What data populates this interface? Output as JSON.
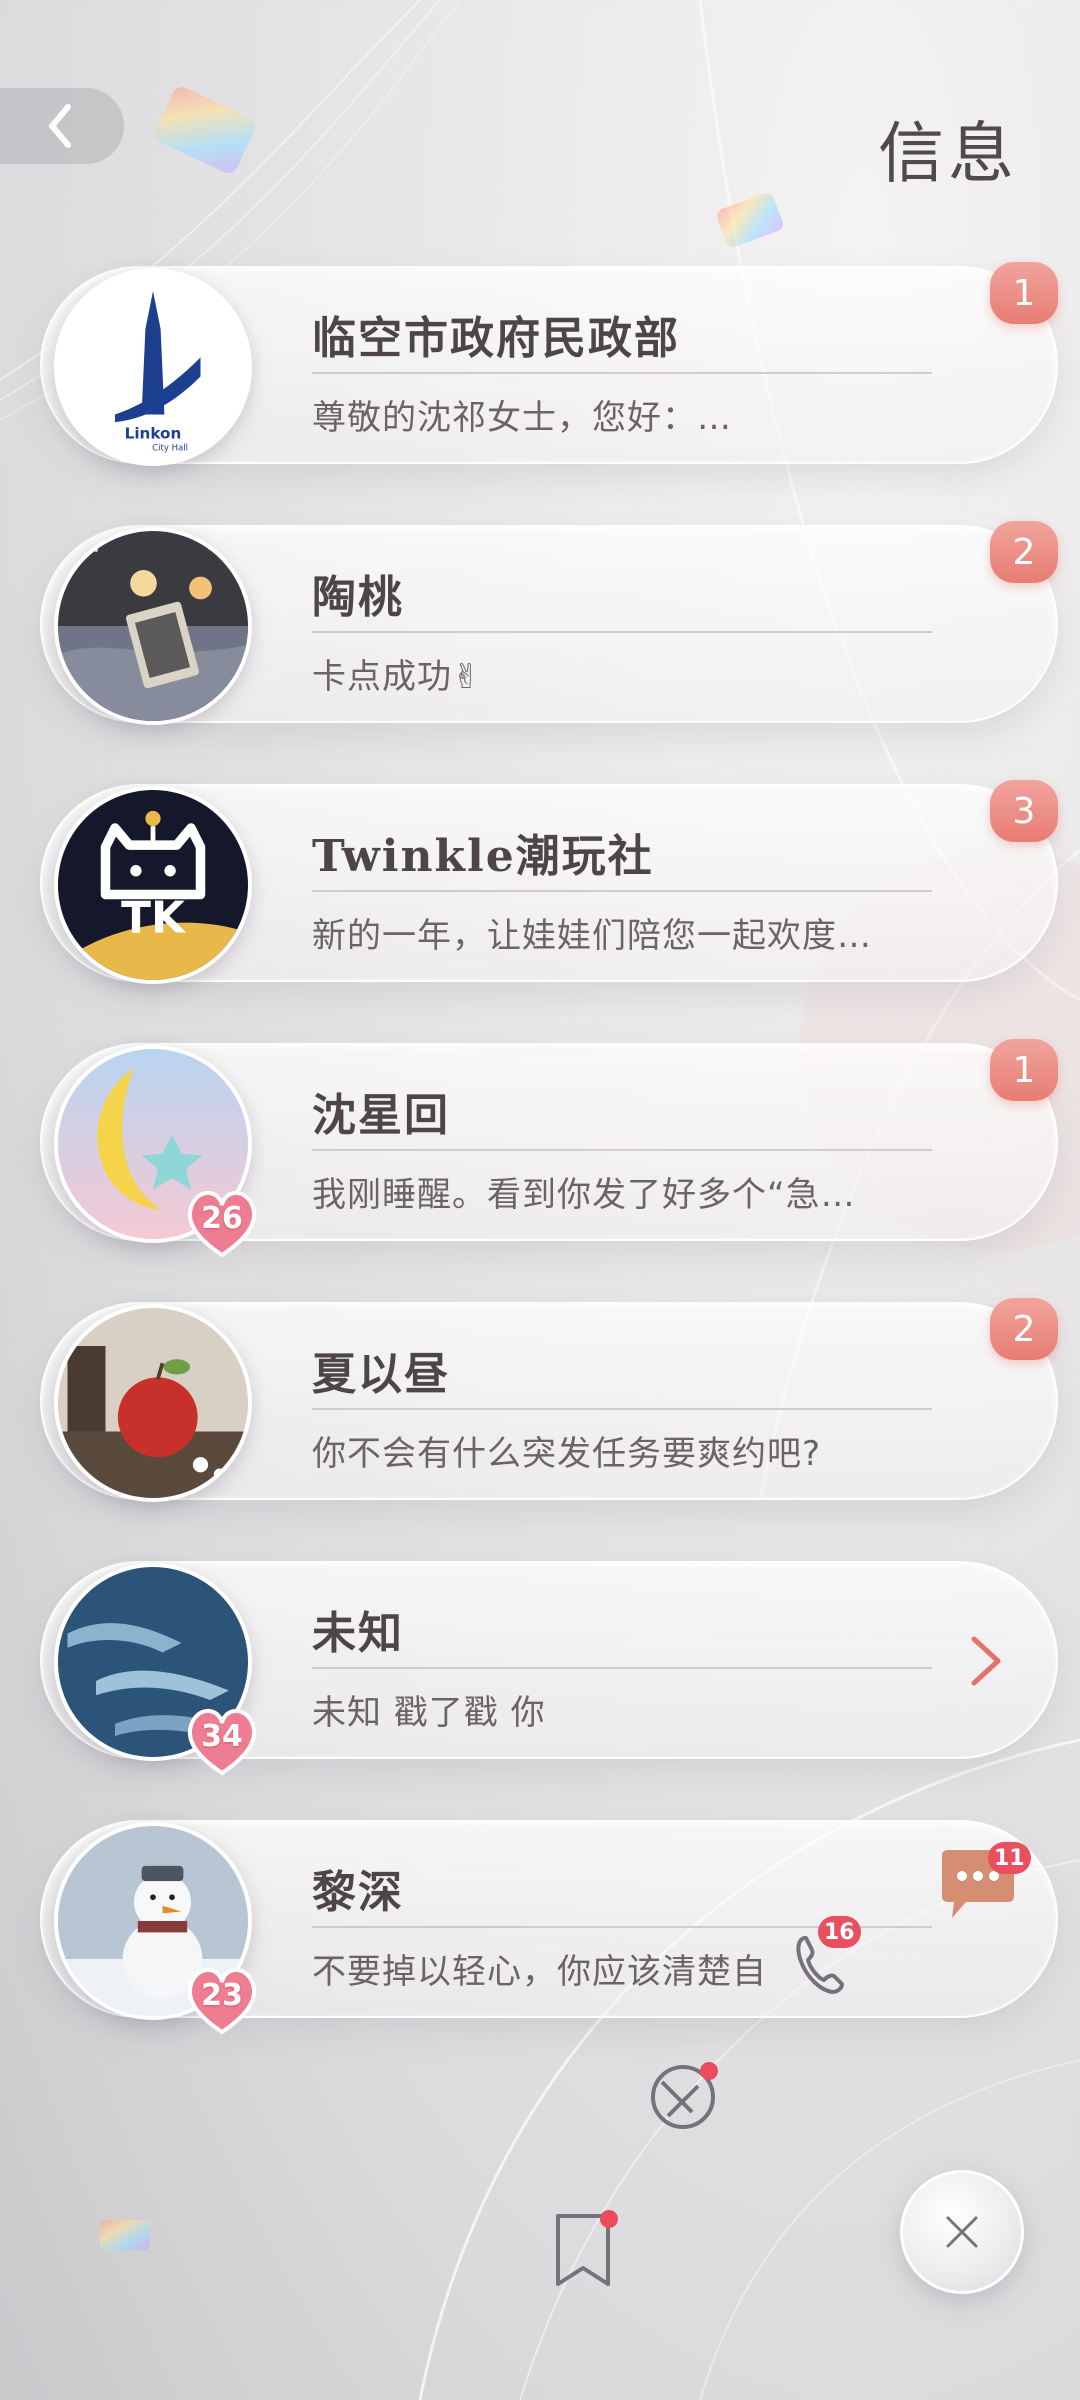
{
  "header": {
    "title": "信息",
    "back_icon": "chevron-left-icon"
  },
  "chats": [
    {
      "name": "临空市政府民政部",
      "preview": "尊敬的沈祁女士，您好：…",
      "unread": "1",
      "avatar_text": "Linkon",
      "avatar_subtext": "City Hall"
    },
    {
      "name": "陶桃",
      "preview": "卡点成功✌",
      "unread": "2"
    },
    {
      "name": "Twinkle潮玩社",
      "preview": "新的一年，让娃娃们陪您一起欢度…",
      "unread": "3",
      "avatar_text": "TK"
    },
    {
      "name": "沈星回",
      "preview": "我刚睡醒。看到你发了好多个“急…",
      "unread": "1",
      "affinity": "26"
    },
    {
      "name": "夏以昼",
      "preview": "你不会有什么突发任务要爽约吧?",
      "unread": "2"
    },
    {
      "name": "未知",
      "preview": "未知 戳了戳 你",
      "affinity": "34"
    },
    {
      "name": "黎深",
      "preview": "不要掉以轻心，你应该清楚自",
      "affinity": "23"
    }
  ],
  "floating": {
    "messages_count": "11",
    "calls_count": "16"
  },
  "colors": {
    "badge": "#e77d73",
    "heart": "#ef7d92",
    "accent_red": "#ec4b5e"
  }
}
